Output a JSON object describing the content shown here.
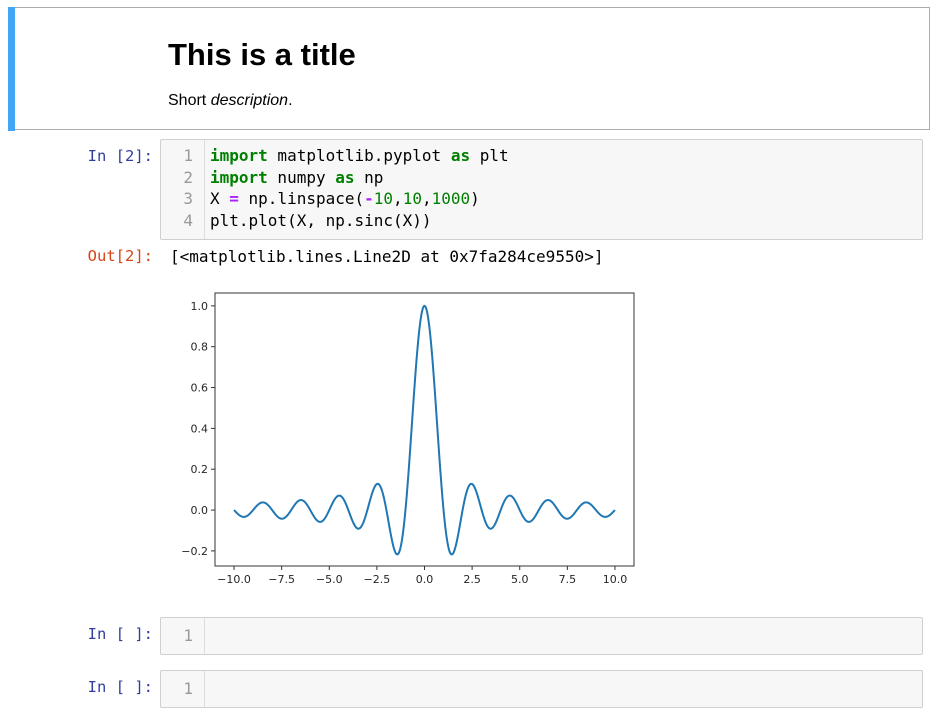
{
  "markdown_cell": {
    "title": "This is a title",
    "description_prefix": "Short ",
    "description_emphasis": "description",
    "description_suffix": ".",
    "accent_color": "#42a5f5"
  },
  "code_cell": {
    "prompt_in": "In [2]:",
    "prompt_out": "Out[2]:",
    "line_numbers": [
      "1",
      "2",
      "3",
      "4"
    ],
    "lines": [
      [
        {
          "t": "import",
          "c": "kw"
        },
        {
          "t": " matplotlib.pyplot ",
          "c": ""
        },
        {
          "t": "as",
          "c": "kw"
        },
        {
          "t": " plt",
          "c": ""
        }
      ],
      [
        {
          "t": "import",
          "c": "kw"
        },
        {
          "t": " numpy ",
          "c": ""
        },
        {
          "t": "as",
          "c": "kw"
        },
        {
          "t": " np",
          "c": ""
        }
      ],
      [
        {
          "t": "X ",
          "c": ""
        },
        {
          "t": "=",
          "c": "op"
        },
        {
          "t": " np.linspace(",
          "c": ""
        },
        {
          "t": "-",
          "c": "op"
        },
        {
          "t": "10",
          "c": "num"
        },
        {
          "t": ",",
          "c": ""
        },
        {
          "t": "10",
          "c": "num"
        },
        {
          "t": ",",
          "c": ""
        },
        {
          "t": "1000",
          "c": "num"
        },
        {
          "t": ")",
          "c": ""
        }
      ],
      [
        {
          "t": "plt.plot(X, np.sinc(X))",
          "c": ""
        }
      ]
    ],
    "output_text": "[<matplotlib.lines.Line2D at 0x7fa284ce9550>]"
  },
  "empty_cells": [
    {
      "prompt": "In [ ]:",
      "line_number": "1"
    },
    {
      "prompt": "In [ ]:",
      "line_number": "1"
    }
  ],
  "chart_data": {
    "type": "line",
    "title": "",
    "xlabel": "",
    "ylabel": "",
    "function": "sinc",
    "x_start": -10,
    "x_end": 10,
    "num_points": 1000,
    "xlim": [
      -11,
      11
    ],
    "ylim": [
      -0.274,
      1.063
    ],
    "x_ticks": [
      -10,
      -7.5,
      -5,
      -2.5,
      0,
      2.5,
      5,
      7.5,
      10
    ],
    "x_tick_labels": [
      "−10.0",
      "−7.5",
      "−5.0",
      "−2.5",
      "0.0",
      "2.5",
      "5.0",
      "7.5",
      "10.0"
    ],
    "y_ticks": [
      -0.2,
      0,
      0.2,
      0.4,
      0.6,
      0.8,
      1.0
    ],
    "y_tick_labels": [
      "−0.2",
      "0.0",
      "0.2",
      "0.4",
      "0.6",
      "0.8",
      "1.0"
    ],
    "grid": false,
    "line_color": "#1f77b4"
  }
}
